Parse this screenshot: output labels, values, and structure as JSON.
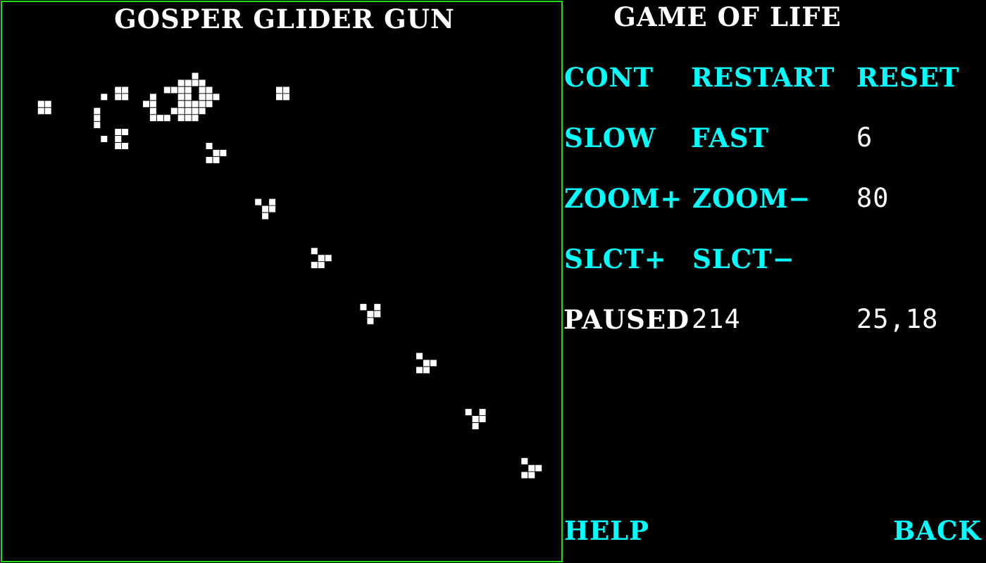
{
  "colors": {
    "background": "#000000",
    "grid_border": "#1ed81e",
    "cell_alive": "#ffffff",
    "control_text": "#00ffff",
    "value_text": "#ffffff"
  },
  "grid": {
    "pattern_name": "GOSPER GLIDER GUN",
    "live_cells": [
      [
        5,
        14
      ],
      [
        6,
        14
      ],
      [
        5,
        15
      ],
      [
        6,
        15
      ],
      [
        13,
        15
      ],
      [
        13,
        16
      ],
      [
        13,
        17
      ],
      [
        14,
        13
      ],
      [
        14,
        19
      ],
      [
        16,
        12
      ],
      [
        17,
        12
      ],
      [
        16,
        20
      ],
      [
        17,
        20
      ],
      [
        16,
        18
      ],
      [
        17,
        18
      ],
      [
        17,
        12
      ],
      [
        17,
        13
      ],
      [
        16,
        13
      ],
      [
        16,
        19
      ],
      [
        20,
        14
      ],
      [
        21,
        14
      ],
      [
        21,
        13
      ],
      [
        21,
        16
      ],
      [
        22,
        16
      ],
      [
        23,
        16
      ],
      [
        21,
        15
      ],
      [
        23,
        12
      ],
      [
        24,
        12
      ],
      [
        25,
        11
      ],
      [
        25,
        12
      ],
      [
        25,
        13
      ],
      [
        25,
        14
      ],
      [
        24,
        15
      ],
      [
        25,
        15
      ],
      [
        26,
        15
      ],
      [
        27,
        15
      ],
      [
        26,
        14
      ],
      [
        27,
        14
      ],
      [
        25,
        16
      ],
      [
        26,
        16
      ],
      [
        26,
        11
      ],
      [
        27,
        10
      ],
      [
        27,
        11
      ],
      [
        26,
        12
      ],
      [
        26,
        13
      ],
      [
        28,
        11
      ],
      [
        28,
        12
      ],
      [
        28,
        13
      ],
      [
        29,
        12
      ],
      [
        29,
        13
      ],
      [
        28,
        14
      ],
      [
        29,
        14
      ],
      [
        30,
        13
      ],
      [
        27,
        16
      ],
      [
        28,
        15
      ],
      [
        39,
        12
      ],
      [
        40,
        12
      ],
      [
        39,
        13
      ],
      [
        40,
        13
      ],
      [
        29,
        20
      ],
      [
        30,
        21
      ],
      [
        31,
        21
      ],
      [
        29,
        22
      ],
      [
        30,
        22
      ],
      [
        36,
        28
      ],
      [
        37,
        29
      ],
      [
        38,
        28
      ],
      [
        38,
        29
      ],
      [
        37,
        30
      ],
      [
        44,
        35
      ],
      [
        45,
        36
      ],
      [
        46,
        36
      ],
      [
        44,
        37
      ],
      [
        45,
        37
      ],
      [
        51,
        43
      ],
      [
        52,
        44
      ],
      [
        53,
        43
      ],
      [
        53,
        44
      ],
      [
        52,
        45
      ],
      [
        59,
        50
      ],
      [
        60,
        51
      ],
      [
        61,
        51
      ],
      [
        59,
        52
      ],
      [
        60,
        52
      ],
      [
        66,
        58
      ],
      [
        67,
        59
      ],
      [
        68,
        58
      ],
      [
        68,
        59
      ],
      [
        67,
        60
      ],
      [
        74,
        65
      ],
      [
        75,
        66
      ],
      [
        76,
        66
      ],
      [
        74,
        67
      ],
      [
        75,
        67
      ]
    ]
  },
  "app": {
    "title": "GAME OF LIFE"
  },
  "controls": {
    "cont": "CONT",
    "restart": "RESTART",
    "reset": "RESET",
    "slow": "SLOW",
    "fast": "FAST",
    "speed_value": "6",
    "zoom_in": "ZOOM+",
    "zoom_out": "ZOOM−",
    "zoom_value": "80",
    "select_next": "SLCT+",
    "select_prev": "SLCT−",
    "status": "PAUSED",
    "generation": "214",
    "cursor": "25,18",
    "help": "HELP",
    "back": "BACK"
  }
}
